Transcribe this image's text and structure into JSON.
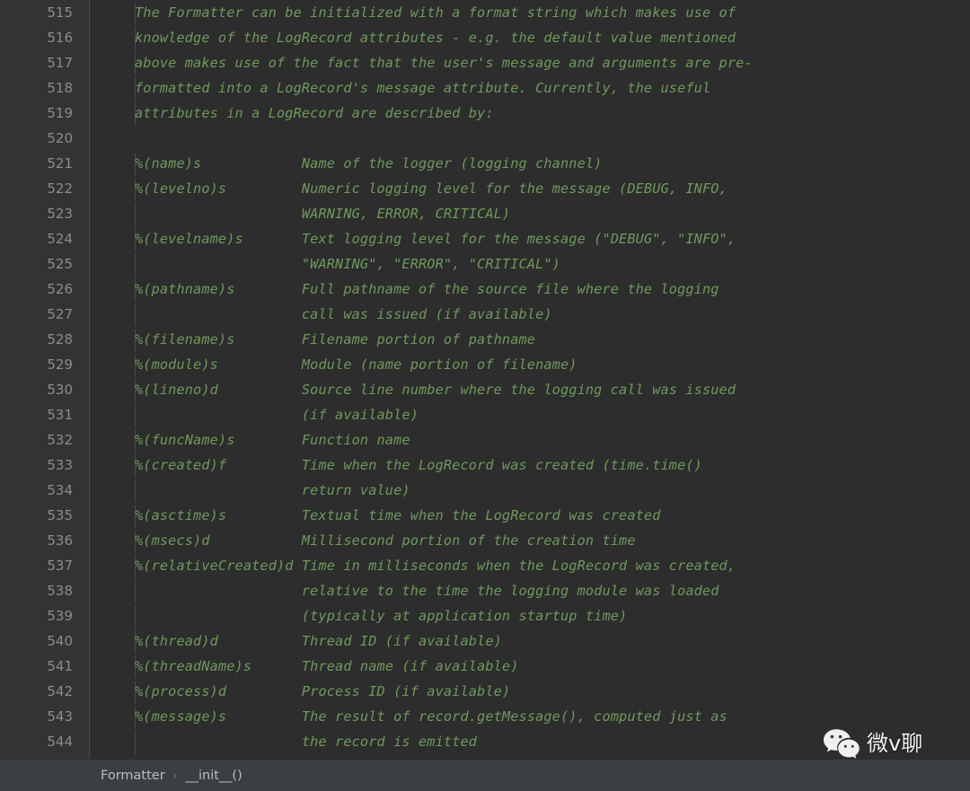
{
  "editor": {
    "language": "python",
    "first_line_number": 515,
    "colors": {
      "background": "#2d2d2d",
      "gutter_background": "#313335",
      "line_number": "#8c8c8c",
      "comment_green": "#6d9a5b",
      "statusbar_background": "#3c3f41",
      "breadcrumb_text": "#bbbbbb"
    },
    "lines": [
      {
        "number": "515",
        "indent": true,
        "text": "The Formatter can be initialized with a format string which makes use of"
      },
      {
        "number": "516",
        "indent": true,
        "text": "knowledge of the LogRecord attributes - e.g. the default value mentioned"
      },
      {
        "number": "517",
        "indent": true,
        "text": "above makes use of the fact that the user's message and arguments are pre-"
      },
      {
        "number": "518",
        "indent": true,
        "text": "formatted into a LogRecord's message attribute. Currently, the useful"
      },
      {
        "number": "519",
        "indent": true,
        "text": "attributes in a LogRecord are described by:"
      },
      {
        "number": "520",
        "indent": false,
        "text": ""
      },
      {
        "number": "521",
        "indent": true,
        "text": "%(name)s            Name of the logger (logging channel)"
      },
      {
        "number": "522",
        "indent": true,
        "text": "%(levelno)s         Numeric logging level for the message (DEBUG, INFO,"
      },
      {
        "number": "523",
        "indent": true,
        "text": "                    WARNING, ERROR, CRITICAL)"
      },
      {
        "number": "524",
        "indent": true,
        "text": "%(levelname)s       Text logging level for the message (\"DEBUG\", \"INFO\","
      },
      {
        "number": "525",
        "indent": true,
        "text": "                    \"WARNING\", \"ERROR\", \"CRITICAL\")"
      },
      {
        "number": "526",
        "indent": true,
        "text": "%(pathname)s        Full pathname of the source file where the logging"
      },
      {
        "number": "527",
        "indent": true,
        "text": "                    call was issued (if available)"
      },
      {
        "number": "528",
        "indent": true,
        "text": "%(filename)s        Filename portion of pathname"
      },
      {
        "number": "529",
        "indent": true,
        "text": "%(module)s          Module (name portion of filename)"
      },
      {
        "number": "530",
        "indent": true,
        "text": "%(lineno)d          Source line number where the logging call was issued"
      },
      {
        "number": "531",
        "indent": true,
        "text": "                    (if available)"
      },
      {
        "number": "532",
        "indent": true,
        "text": "%(funcName)s        Function name"
      },
      {
        "number": "533",
        "indent": true,
        "text": "%(created)f         Time when the LogRecord was created (time.time()"
      },
      {
        "number": "534",
        "indent": true,
        "text": "                    return value)"
      },
      {
        "number": "535",
        "indent": true,
        "text": "%(asctime)s         Textual time when the LogRecord was created"
      },
      {
        "number": "536",
        "indent": true,
        "text": "%(msecs)d           Millisecond portion of the creation time"
      },
      {
        "number": "537",
        "indent": true,
        "text": "%(relativeCreated)d Time in milliseconds when the LogRecord was created,"
      },
      {
        "number": "538",
        "indent": true,
        "text": "                    relative to the time the logging module was loaded"
      },
      {
        "number": "539",
        "indent": true,
        "text": "                    (typically at application startup time)"
      },
      {
        "number": "540",
        "indent": true,
        "text": "%(thread)d          Thread ID (if available)"
      },
      {
        "number": "541",
        "indent": true,
        "text": "%(threadName)s      Thread name (if available)"
      },
      {
        "number": "542",
        "indent": true,
        "text": "%(process)d         Process ID (if available)"
      },
      {
        "number": "543",
        "indent": true,
        "text": "%(message)s         The result of record.getMessage(), computed just as"
      },
      {
        "number": "544",
        "indent": true,
        "text": "                    the record is emitted"
      }
    ]
  },
  "statusbar": {
    "breadcrumb": [
      {
        "label": "Formatter"
      },
      {
        "label": "__init__()"
      }
    ],
    "separator": "›"
  },
  "watermark": {
    "icon": "wechat-logo-icon",
    "text": "微v聊"
  }
}
